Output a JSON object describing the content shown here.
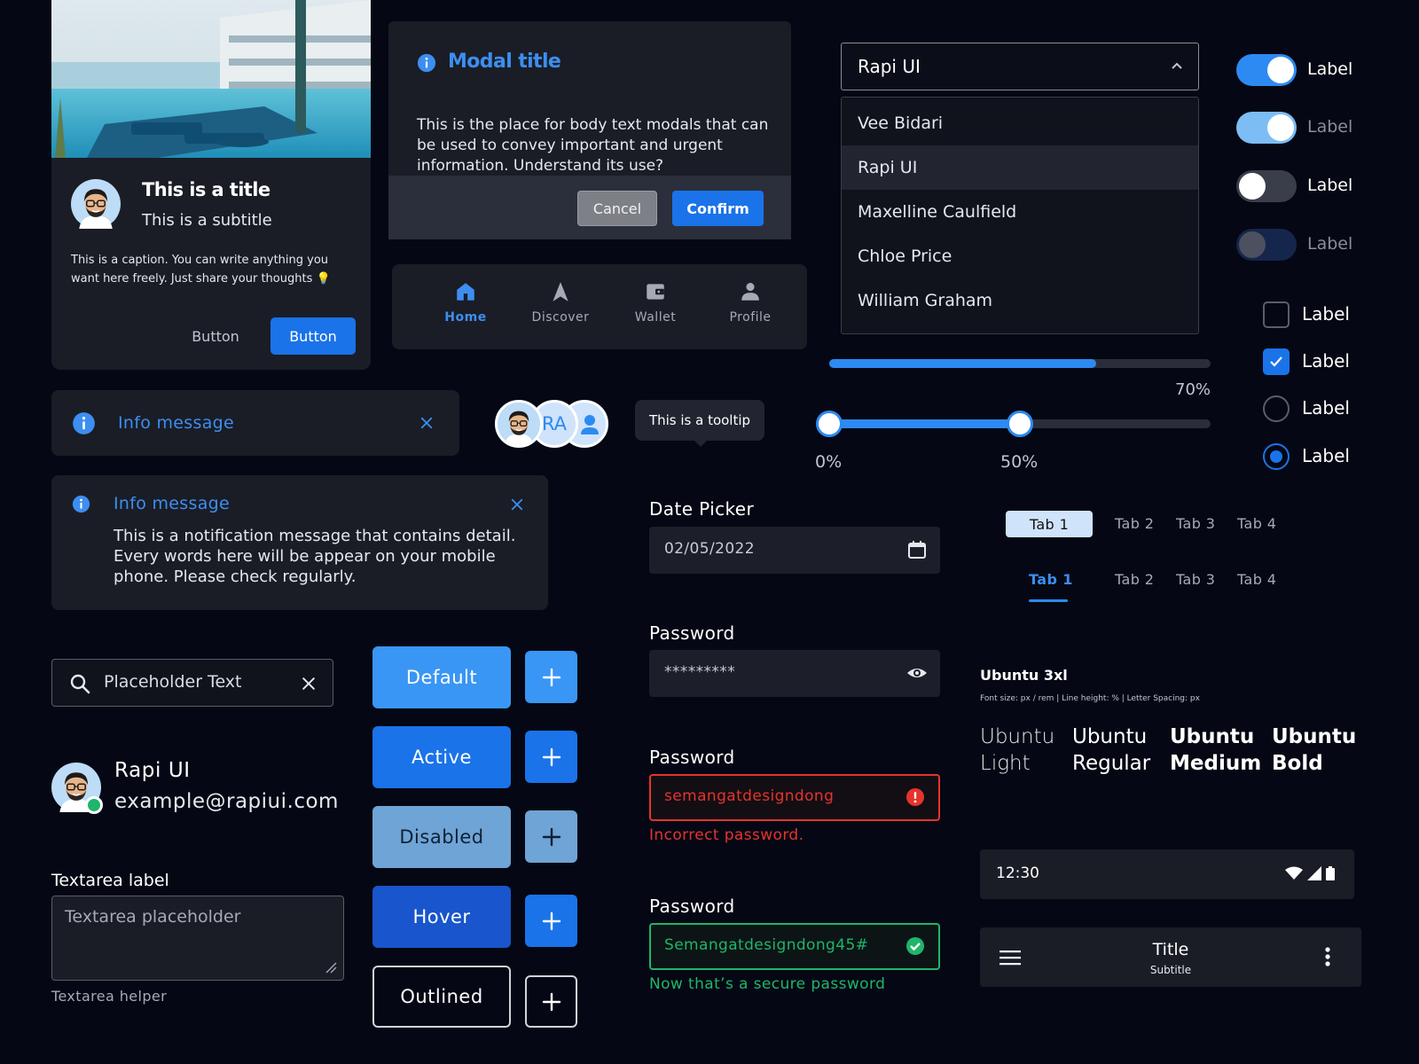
{
  "card": {
    "title": "This is a title",
    "subtitle": "This is a subtitle",
    "caption": "This is a caption. You can write anything you want here freely. Just share your thoughts 💡",
    "button_ghost": "Button",
    "button_primary": "Button"
  },
  "modal": {
    "title": "Modal title",
    "body": "This is the place for body text modals that can be used to convey important and urgent information. Understand its use?",
    "cancel": "Cancel",
    "confirm": "Confirm"
  },
  "bottom_nav": {
    "items": [
      {
        "label": "Home",
        "icon": "home-icon",
        "active": true
      },
      {
        "label": "Discover",
        "icon": "navigation-arrow-icon",
        "active": false
      },
      {
        "label": "Wallet",
        "icon": "wallet-icon",
        "active": false
      },
      {
        "label": "Profile",
        "icon": "person-icon",
        "active": false
      }
    ]
  },
  "select": {
    "value": "Rapi UI",
    "options": [
      "Vee Bidari",
      "Rapi UI",
      "Maxelline Caulfield",
      "Chloe Price",
      "William Graham"
    ],
    "selected_index": 1
  },
  "toggles": [
    {
      "label": "Label",
      "on": true,
      "disabled": false
    },
    {
      "label": "Label",
      "on": true,
      "disabled": true
    },
    {
      "label": "Label",
      "on": false,
      "disabled": false
    },
    {
      "label": "Label",
      "on": false,
      "disabled": true
    }
  ],
  "checkboxes": [
    {
      "label": "Label",
      "checked": false
    },
    {
      "label": "Label",
      "checked": true
    }
  ],
  "radios": [
    {
      "label": "Label",
      "checked": false
    },
    {
      "label": "Label",
      "checked": true
    }
  ],
  "progress": {
    "value": 0.7,
    "label": "70%"
  },
  "range": {
    "low": 0,
    "high": 0.5,
    "low_label": "0%",
    "high_label": "50%"
  },
  "info_short": {
    "text": "Info message"
  },
  "info_long": {
    "title": "Info message",
    "body": "This is a notification message that contains detail. Every words here will be appear on your mobile phone. Please check regularly."
  },
  "avatar_group": {
    "initials": "RA"
  },
  "tooltip": {
    "text": "This is a tooltip"
  },
  "date_picker": {
    "label": "Date Picker",
    "value": "02/05/2022"
  },
  "password_default": {
    "label": "Password",
    "value": "*********"
  },
  "password_error": {
    "label": "Password",
    "value": "semangatdesigndong",
    "helper": "Incorrect password."
  },
  "password_success": {
    "label": "Password",
    "value": "Semangatdesigndong45#",
    "helper": "Now that’s a secure password"
  },
  "tabs_pill": [
    "Tab 1",
    "Tab 2",
    "Tab 3",
    "Tab 4"
  ],
  "tabs_underline": [
    "Tab 1",
    "Tab 2",
    "Tab 3",
    "Tab 4"
  ],
  "typography": {
    "title": "Ubuntu 3xl",
    "meta": "Font size: px / rem | Line height: % | Letter Spacing: px",
    "weights": [
      {
        "line1": "Ubuntu",
        "line2": "Light"
      },
      {
        "line1": "Ubuntu",
        "line2": "Regular"
      },
      {
        "line1": "Ubuntu",
        "line2": "Medium"
      },
      {
        "line1": "Ubuntu",
        "line2": "Bold"
      }
    ]
  },
  "search": {
    "placeholder": "Placeholder Text"
  },
  "user": {
    "name": "Rapi UI",
    "email": "example@rapiui.com"
  },
  "textarea": {
    "label": "Textarea label",
    "placeholder": "Textarea placeholder",
    "helper": "Textarea helper"
  },
  "buttons": {
    "default": "Default",
    "active": "Active",
    "disabled": "Disabled",
    "hover": "Hover",
    "outlined": "Outlined"
  },
  "status_bar": {
    "time": "12:30"
  },
  "app_bar": {
    "title": "Title",
    "subtitle": "Subtitle"
  },
  "colors": {
    "background": "#050814",
    "surface": "#1a1d26",
    "primary": "#1a73e8",
    "accent_text": "#3d8ef0",
    "error": "#e5342b",
    "success": "#1fb56a"
  }
}
